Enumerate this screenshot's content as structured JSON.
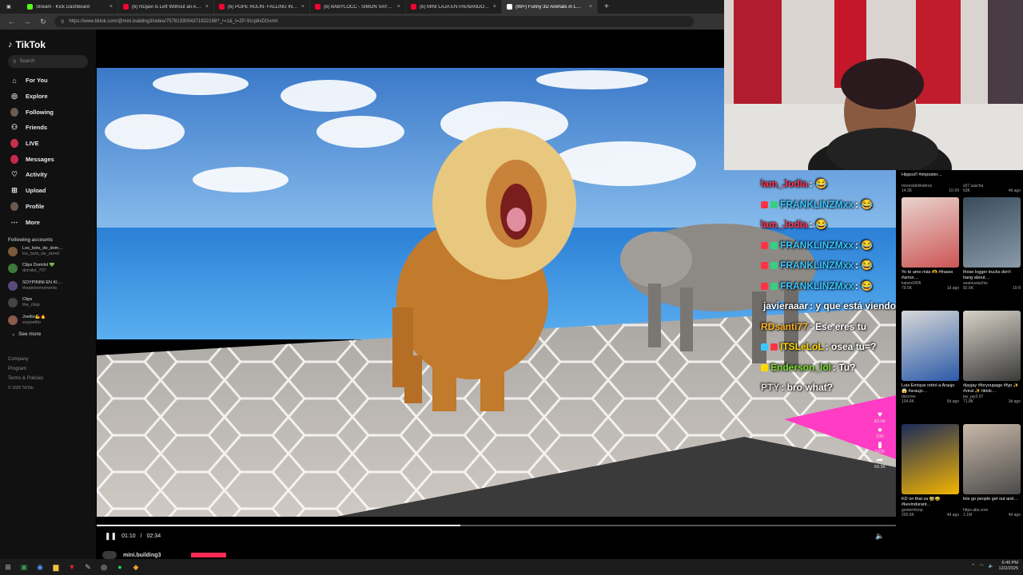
{
  "browser": {
    "tabs": [
      {
        "title": "Stream - Kick Dashboard",
        "color": "#53fc18"
      },
      {
        "title": "(6) RDjavi Is Left Without an Ans…",
        "color": "#ff0033"
      },
      {
        "title": "(6) POPE RULIN- FALLING IN LOVE",
        "color": "#ff0033"
      },
      {
        "title": "(6) BABYLOCC - SIMON SAYS (Vi…",
        "color": "#ff0033"
      },
      {
        "title": "(6) MINI LAJA ENTRENANDO PAR…",
        "color": "#ff0033"
      },
      {
        "title": "(99+) Funny 3D Animals in L…",
        "color": "#ffffff",
        "active": true
      }
    ],
    "url": "https://www.tiktok.com/@mini.building3/video/7578133004371922198?_r=1&_t=ZP-91rp8vDOvmh"
  },
  "sidebar": {
    "logo": "TikTok",
    "search_placeholder": "Search",
    "nav": [
      {
        "label": "For You",
        "icon": "home-icon"
      },
      {
        "label": "Explore",
        "icon": "compass-icon"
      },
      {
        "label": "Following",
        "icon": "following-avatar-icon"
      },
      {
        "label": "Friends",
        "icon": "friends-icon"
      },
      {
        "label": "LIVE",
        "icon": "live-icon"
      },
      {
        "label": "Messages",
        "icon": "messages-icon"
      },
      {
        "label": "Activity",
        "icon": "activity-icon"
      },
      {
        "label": "Upload",
        "icon": "upload-icon"
      },
      {
        "label": "Profile",
        "icon": "profile-icon"
      },
      {
        "label": "More",
        "icon": "more-icon"
      }
    ],
    "following_label": "Following accounts",
    "accounts": [
      {
        "name": "Los_bots_de_dom…",
        "handle": "los_bots_de_domil",
        "color": "#7a5a3a"
      },
      {
        "name": "Clips Domilol 💚",
        "handle": "domilol_707",
        "color": "#3c7a3a"
      },
      {
        "name": "SOYPININI EN KI…",
        "handle": "thepininimoments",
        "color": "#5a4a7a"
      },
      {
        "name": "Clips",
        "handle": "the_clisp",
        "color": "#444"
      },
      {
        "name": "Joelito💪🔥",
        "handle": "soyjoelito",
        "color": "#8a5a4a"
      }
    ],
    "see_more": "See more",
    "footer": [
      "Company",
      "Program",
      "Terms & Policies"
    ],
    "copyright": "© 2025 TikTok"
  },
  "video": {
    "elapsed": "01:10",
    "duration": "02:34",
    "progress_fraction": 0.455,
    "creator": "mini.building3"
  },
  "actions": [
    {
      "icon": "heart-icon",
      "count": "83.6K"
    },
    {
      "icon": "comment-icon",
      "count": "930"
    },
    {
      "icon": "bookmark-icon",
      "count": "5330"
    },
    {
      "icon": "share-icon",
      "count": "69.3K"
    }
  ],
  "chat": [
    {
      "user": "lam_Jodia",
      "text": ": 😂",
      "color": "#ff3355",
      "badges": []
    },
    {
      "user": "FRANKLINZMxx",
      "text": ": 😂",
      "color": "#39c6ff",
      "badges": [
        "#ff3344",
        "#35d07f"
      ]
    },
    {
      "user": "lam_Jodia",
      "text": ": 😂",
      "color": "#ff3355",
      "badges": []
    },
    {
      "user": "FRANKLINZMxx",
      "text": ": 😂",
      "color": "#39c6ff",
      "badges": [
        "#ff3344",
        "#35d07f"
      ]
    },
    {
      "user": "FRANKLINZMxx",
      "text": ": 😂",
      "color": "#39c6ff",
      "badges": [
        "#ff3344",
        "#35d07f"
      ]
    },
    {
      "user": "FRANKLINZMxx",
      "text": ": 😂",
      "color": "#39c6ff",
      "badges": [
        "#ff3344",
        "#35d07f"
      ]
    },
    {
      "user": "javieraaar",
      "text": ": y que está viendo este mmg?",
      "color": "#ffffff",
      "badges": [
        "#999"
      ]
    },
    {
      "user": "RDsanti77",
      "text": ": Ese eres tu",
      "color": "#ffb020",
      "badges": []
    },
    {
      "user": "ITSLeLoL",
      "text": ": osea tu=?",
      "color": "#ffd800",
      "badges": [
        "#39c6ff",
        "#ff3344"
      ]
    },
    {
      "user": "Enderson_lol",
      "text": ": Tu?",
      "color": "#7ddc2f",
      "badges": [
        "#ffd800"
      ]
    },
    {
      "user": "PTY",
      "text": ": bro what?",
      "color": "#dddddd",
      "badges": []
    }
  ],
  "recommendations": {
    "left": [
      {
        "caption": "Hippos‼ #imposter…",
        "user": "moresidelinebros",
        "views": "14.3K",
        "date": "10-29"
      },
      {
        "caption": "Yo te amo más 🫶 #frases #amor…",
        "user": "kaiser0405",
        "views": "79.5K",
        "date": "1d ago"
      },
      {
        "caption": "Luis Enrique retiró a Araujo 😱 #araujo…",
        "user": "descree",
        "views": "104.6K",
        "date": "5d ago"
      },
      {
        "caption": "KD on that za 🤣😂 #kevindurant…",
        "user": "gooberhoop",
        "views": "205.6K",
        "date": "4d ago"
      }
    ],
    "right": [
      {
        "caption": "",
        "user": "s07.sascha",
        "views": "63K",
        "date": "4d ago"
      },
      {
        "caption": "those logger trucks don't hang about…",
        "user": "seamustachio",
        "views": "82.6K",
        "date": "10-8"
      },
      {
        "caption": "#jayjay #foryoupage #fyp ✨ #viral ✨ tiktok…",
        "user": "jay_jay2.07",
        "views": "71.8K",
        "date": "3d ago"
      },
      {
        "caption": "lets go people get out and…",
        "user": "https.abs.com",
        "views": "1.1M",
        "date": "4d ago"
      }
    ],
    "thumb_tags": [
      "LUIS ENRIQUE RETIRÓ A ARAUJO"
    ]
  },
  "taskbar": {
    "time": "6:49 PM",
    "date": "12/2/2025"
  }
}
